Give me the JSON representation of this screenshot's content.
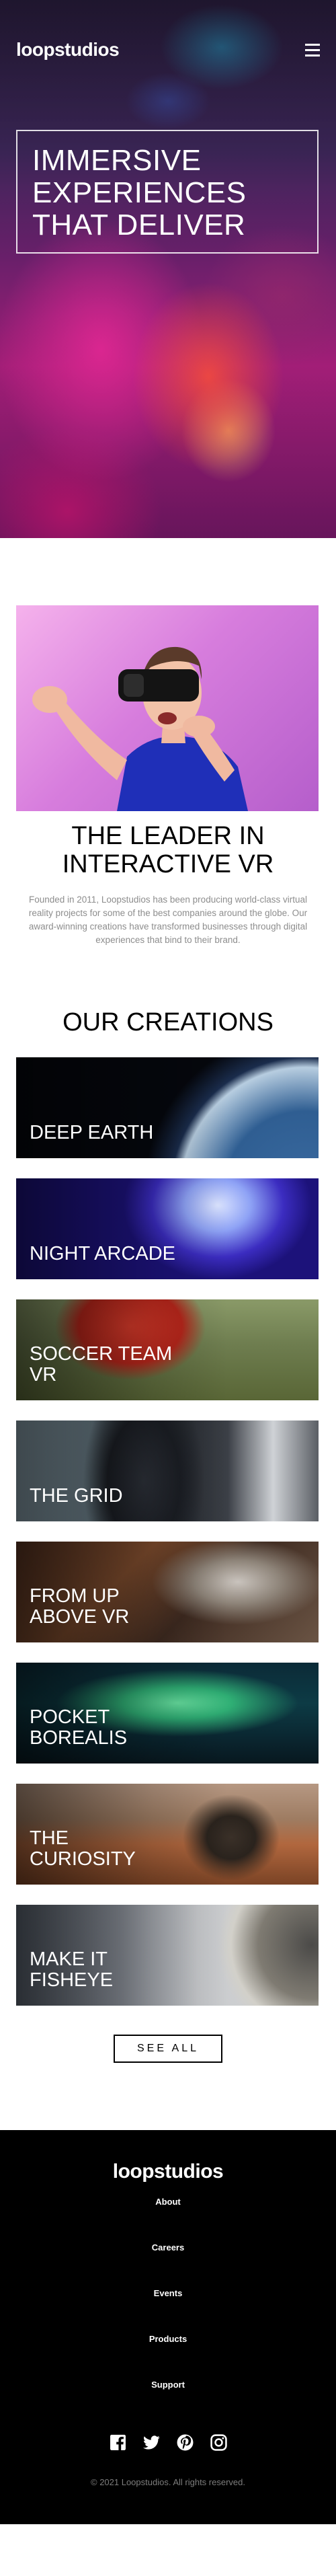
{
  "header": {
    "logo": "loopstudios",
    "menu_icon": "hamburger-menu-icon"
  },
  "hero": {
    "title": "Immersive experiences that deliver"
  },
  "intro": {
    "title": "The leader in interactive VR",
    "text": "Founded in 2011, Loopstudios has been producing world-class virtual reality projects for some of the best companies around the globe. Our award-winning creations have transformed businesses through digital experiences that bind to their brand."
  },
  "creations": {
    "title": "Our creations",
    "items": [
      {
        "label": "Deep earth"
      },
      {
        "label": "Night arcade"
      },
      {
        "label": "Soccer team VR"
      },
      {
        "label": "The grid"
      },
      {
        "label": "From up above VR"
      },
      {
        "label": "Pocket borealis"
      },
      {
        "label": "The curiosity"
      },
      {
        "label": "Make it fisheye"
      }
    ],
    "see_all": "See all"
  },
  "footer": {
    "logo": "loopstudios",
    "nav": [
      "About",
      "Careers",
      "Events",
      "Products",
      "Support"
    ],
    "socials": [
      "facebook-icon",
      "twitter-icon",
      "pinterest-icon",
      "instagram-icon"
    ],
    "copyright": "© 2021 Loopstudios. All rights reserved."
  }
}
